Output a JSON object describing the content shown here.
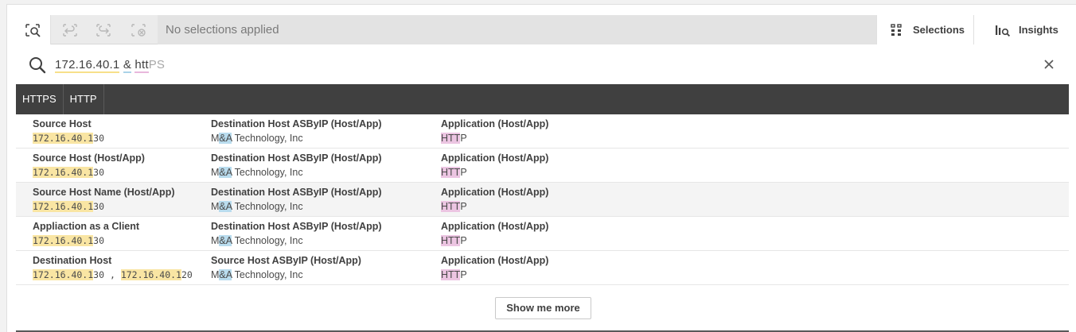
{
  "toolbar": {
    "status": "No selections applied",
    "selections_label": "Selections",
    "insights_label": "Insights"
  },
  "search": {
    "query": {
      "part1": "172.16.40.1",
      "sep1": " ",
      "part2": "&",
      "sep2": " ",
      "part3": "htt",
      "suggestion": "PS"
    }
  },
  "chips": [
    "HTTPS",
    "HTTP"
  ],
  "results": [
    {
      "col1": {
        "label": "Source Host",
        "hl": "172.16.40.1",
        "rest": "30"
      },
      "col2": {
        "label": "Destination Host ASByIP (Host/App)",
        "pre": "M",
        "hl": "&A",
        "post": " Technology, Inc"
      },
      "col3": {
        "label": "Application (Host/App)",
        "hl": "HTT",
        "rest": "P"
      }
    },
    {
      "col1": {
        "label": "Source Host (Host/App)",
        "hl": "172.16.40.1",
        "rest": "30"
      },
      "col2": {
        "label": "Destination Host ASByIP (Host/App)",
        "pre": "M",
        "hl": "&A",
        "post": " Technology, Inc"
      },
      "col3": {
        "label": "Application (Host/App)",
        "hl": "HTT",
        "rest": "P"
      }
    },
    {
      "col1": {
        "label": "Source Host Name (Host/App)",
        "hl": "172.16.40.1",
        "rest": "30"
      },
      "col2": {
        "label": "Destination Host ASByIP (Host/App)",
        "pre": "M",
        "hl": "&A",
        "post": " Technology, Inc"
      },
      "col3": {
        "label": "Application (Host/App)",
        "hl": "HTT",
        "rest": "P"
      }
    },
    {
      "col1": {
        "label": "Appliaction as a Client",
        "hl": "172.16.40.1",
        "rest": "30"
      },
      "col2": {
        "label": "Destination Host ASByIP (Host/App)",
        "pre": "M",
        "hl": "&A",
        "post": " Technology, Inc"
      },
      "col3": {
        "label": "Application (Host/App)",
        "hl": "HTT",
        "rest": "P"
      }
    },
    {
      "col1": {
        "label": "Destination Host",
        "hl": "172.16.40.1",
        "rest": "30",
        "sep": " , ",
        "hl2": "172.16.40.1",
        "rest2": "20"
      },
      "col2": {
        "label": "Source Host ASByIP (Host/App)",
        "pre": "M",
        "hl": "&A",
        "post": " Technology, Inc"
      },
      "col3": {
        "label": "Application (Host/App)",
        "hl": "HTT",
        "rest": "P"
      }
    }
  ],
  "show_more_label": "Show me more",
  "icons": {
    "smart_search": "smart-search-icon",
    "step_back": "step-back-icon",
    "step_forward": "step-forward-icon",
    "clear_selections": "clear-selections-icon",
    "selections": "selections-grid-icon",
    "insights": "insights-icon",
    "search": "search-icon",
    "close": "close-icon"
  },
  "colors": {
    "highlight_ip": "#f9e5a3",
    "highlight_amp": "#b9dcee",
    "highlight_app": "#ecc5e2",
    "chips_bar": "#404040"
  }
}
